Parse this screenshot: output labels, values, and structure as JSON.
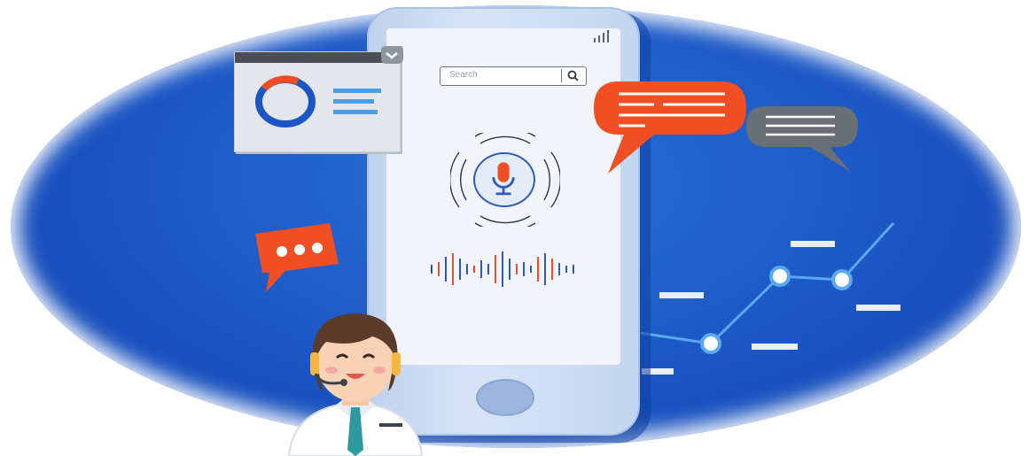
{
  "search": {
    "placeholder": "Search"
  },
  "icons": {
    "search": "search-icon",
    "microphone": "microphone-icon",
    "signal": "signal-bars-icon",
    "chevron": "chevron-down-icon",
    "chat_typing": "chat-typing-icon"
  },
  "colors": {
    "background_blue": "#1b56c4",
    "accent_orange": "#f04e23",
    "mic_blue": "#2e5cb8",
    "chart_line": "#5aa8f0",
    "bubble_gray": "#6a6f76"
  }
}
